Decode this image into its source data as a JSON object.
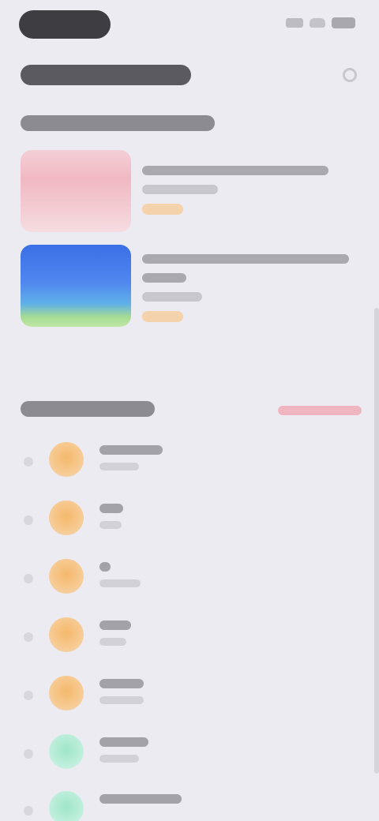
{
  "header": {
    "title": "",
    "action_icon": "more-icon"
  },
  "featured": {
    "heading": "",
    "items": [
      {
        "title": "",
        "subtitle": "",
        "tag": "",
        "color": "#f2b9c2"
      },
      {
        "title": "",
        "subtitle": "",
        "tag": "",
        "color": "#4f86ef"
      }
    ]
  },
  "ranking": {
    "heading": "",
    "link": "",
    "items": [
      {
        "name": "",
        "detail": "",
        "avatar_color": "#f4b86c"
      },
      {
        "name": "",
        "detail": "",
        "avatar_color": "#f4b86c"
      },
      {
        "name": "",
        "detail": "",
        "avatar_color": "#f4b86c"
      },
      {
        "name": "",
        "detail": "",
        "avatar_color": "#f4b86c"
      },
      {
        "name": "",
        "detail": "",
        "avatar_color": "#f4b86c"
      },
      {
        "name": "",
        "detail": "",
        "avatar_color": "#9fe6c8"
      },
      {
        "name": "",
        "detail": "",
        "avatar_color": "#9fe6c8"
      }
    ]
  }
}
